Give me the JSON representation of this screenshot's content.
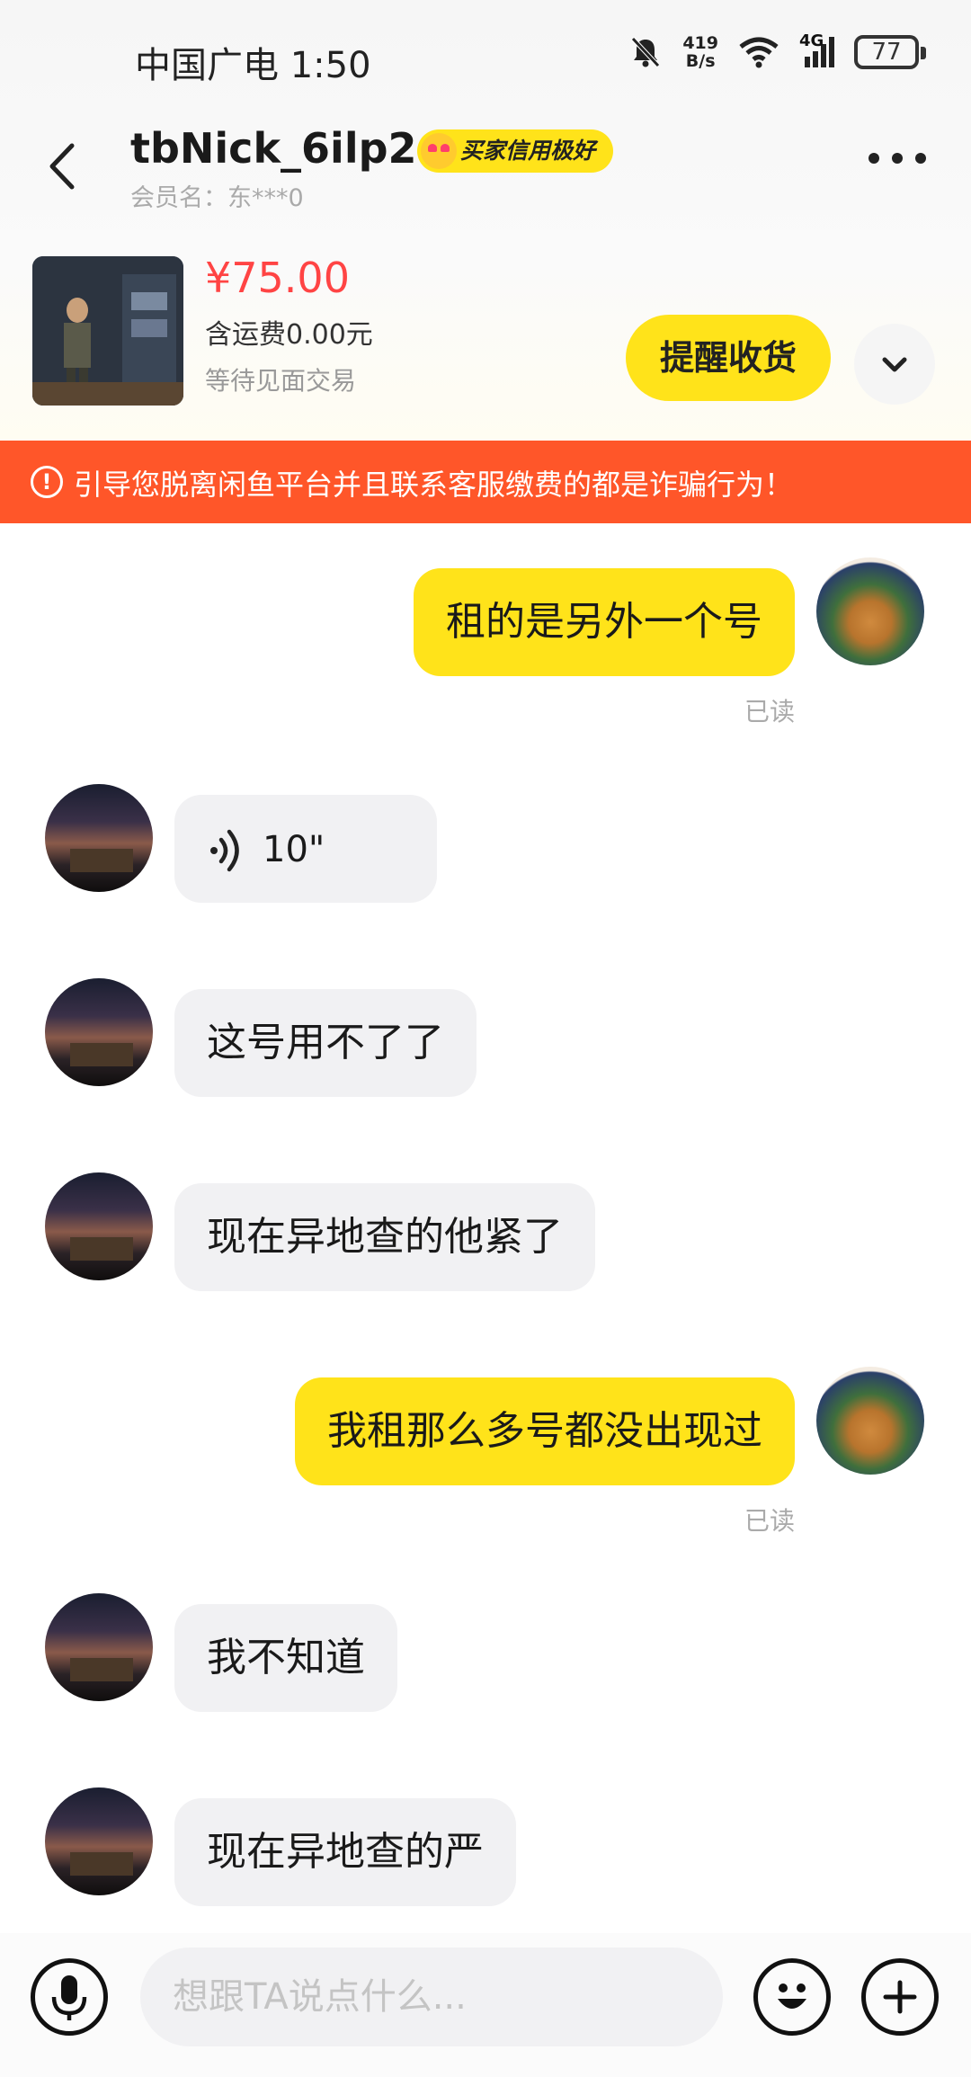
{
  "status_bar": {
    "carrier_time": "中国广电 1:50",
    "net_speed_value": "419",
    "net_speed_unit": "B/s",
    "network": "4G",
    "battery": "77"
  },
  "header": {
    "nickname": "tbNick_6ilp2",
    "credit_badge": "买家信用极好",
    "member_name": "会员名：东***0"
  },
  "product": {
    "price": "¥75.00",
    "shipping": "含运费0.00元",
    "status": "等待见面交易",
    "remind_button": "提醒收货"
  },
  "warning": {
    "icon": "!",
    "text": "引导您脱离闲鱼平台并且联系客服缴费的都是诈骗行为！"
  },
  "messages": [
    {
      "from": "self",
      "text": "租的是另外一个号",
      "read": "已读"
    },
    {
      "from": "other",
      "type": "voice",
      "text": "10\""
    },
    {
      "from": "other",
      "text": "这号用不了了"
    },
    {
      "from": "other",
      "text": "现在异地查的他紧了"
    },
    {
      "from": "self",
      "text": "我租那么多号都没出现过",
      "read": "已读"
    },
    {
      "from": "other",
      "text": "我不知道"
    },
    {
      "from": "other",
      "text": "现在异地查的严"
    }
  ],
  "input": {
    "placeholder": "想跟TA说点什么..."
  },
  "colors": {
    "accent_yellow": "#ffe31a",
    "warning_orange": "#ff5629",
    "price_red": "#ff4444"
  },
  "icons": [
    "back-icon",
    "more-icon",
    "chevron-down-icon",
    "alert-icon",
    "voice-icon",
    "mic-icon",
    "emoji-icon",
    "plus-icon"
  ]
}
